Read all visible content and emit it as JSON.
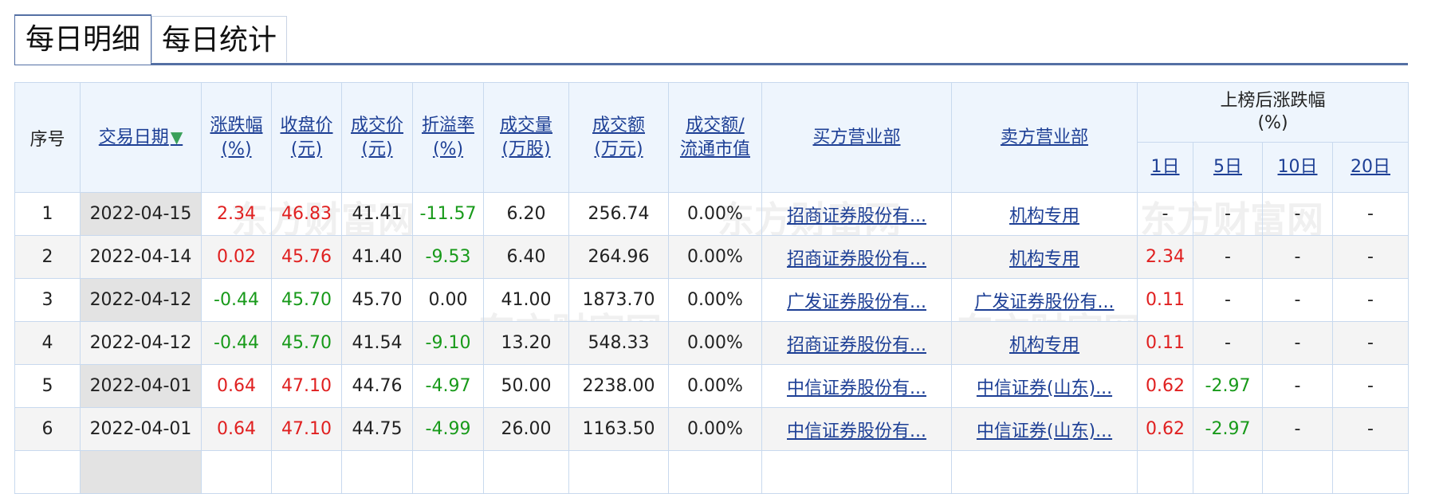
{
  "tabs": [
    {
      "label": "每日明细",
      "active": true
    },
    {
      "label": "每日统计",
      "active": false
    }
  ],
  "watermark": "东方财富网",
  "table": {
    "headers": {
      "index": "序号",
      "date": "交易日期",
      "change_pct": [
        "涨跌幅",
        "(%)"
      ],
      "close": [
        "收盘价",
        "(元)"
      ],
      "deal_price": [
        "成交价",
        "(元)"
      ],
      "premium": [
        "折溢率",
        "(%)"
      ],
      "volume": [
        "成交量",
        "(万股)"
      ],
      "amount": [
        "成交额",
        "(万元)"
      ],
      "amount_ratio": [
        "成交额/",
        "流通市值"
      ],
      "buyer": "买方营业部",
      "seller": "卖方营业部",
      "post": [
        "上榜后涨跌幅",
        "(%)"
      ],
      "d1": "1日",
      "d5": "5日",
      "d10": "10日",
      "d20": "20日"
    },
    "rows": [
      {
        "idx": "1",
        "date": "2022-04-15",
        "chg": "2.34",
        "close": "46.83",
        "deal": "41.41",
        "prem": "-11.57",
        "vol": "6.20",
        "amt": "256.74",
        "ratio": "0.00%",
        "buyer": "招商证券股份有...",
        "seller": "机构专用",
        "d1": "-",
        "d5": "-",
        "d10": "-",
        "d20": "-"
      },
      {
        "idx": "2",
        "date": "2022-04-14",
        "chg": "0.02",
        "close": "45.76",
        "deal": "41.40",
        "prem": "-9.53",
        "vol": "6.40",
        "amt": "264.96",
        "ratio": "0.00%",
        "buyer": "招商证券股份有...",
        "seller": "机构专用",
        "d1": "2.34",
        "d5": "-",
        "d10": "-",
        "d20": "-"
      },
      {
        "idx": "3",
        "date": "2022-04-12",
        "chg": "-0.44",
        "close": "45.70",
        "deal": "45.70",
        "prem": "0.00",
        "vol": "41.00",
        "amt": "1873.70",
        "ratio": "0.00%",
        "buyer": "广发证券股份有...",
        "seller": "广发证券股份有...",
        "d1": "0.11",
        "d5": "-",
        "d10": "-",
        "d20": "-"
      },
      {
        "idx": "4",
        "date": "2022-04-12",
        "chg": "-0.44",
        "close": "45.70",
        "deal": "41.54",
        "prem": "-9.10",
        "vol": "13.20",
        "amt": "548.33",
        "ratio": "0.00%",
        "buyer": "招商证券股份有...",
        "seller": "机构专用",
        "d1": "0.11",
        "d5": "-",
        "d10": "-",
        "d20": "-"
      },
      {
        "idx": "5",
        "date": "2022-04-01",
        "chg": "0.64",
        "close": "47.10",
        "deal": "44.76",
        "prem": "-4.97",
        "vol": "50.00",
        "amt": "2238.00",
        "ratio": "0.00%",
        "buyer": "中信证券股份有...",
        "seller": "中信证券(山东)...",
        "d1": "0.62",
        "d5": "-2.97",
        "d10": "-",
        "d20": "-"
      },
      {
        "idx": "6",
        "date": "2022-04-01",
        "chg": "0.64",
        "close": "47.10",
        "deal": "44.75",
        "prem": "-4.99",
        "vol": "26.00",
        "amt": "1163.50",
        "ratio": "0.00%",
        "buyer": "中信证券股份有...",
        "seller": "中信证券(山东)...",
        "d1": "0.62",
        "d5": "-2.97",
        "d10": "-",
        "d20": "-"
      }
    ]
  },
  "colors": {
    "up": "#e02020",
    "down": "#189a1a",
    "link": "#1d3f95",
    "header_bg": "#eef5fd",
    "border": "#c8d9ee"
  },
  "icons": {
    "sort": "sort-down-arrow-icon"
  }
}
